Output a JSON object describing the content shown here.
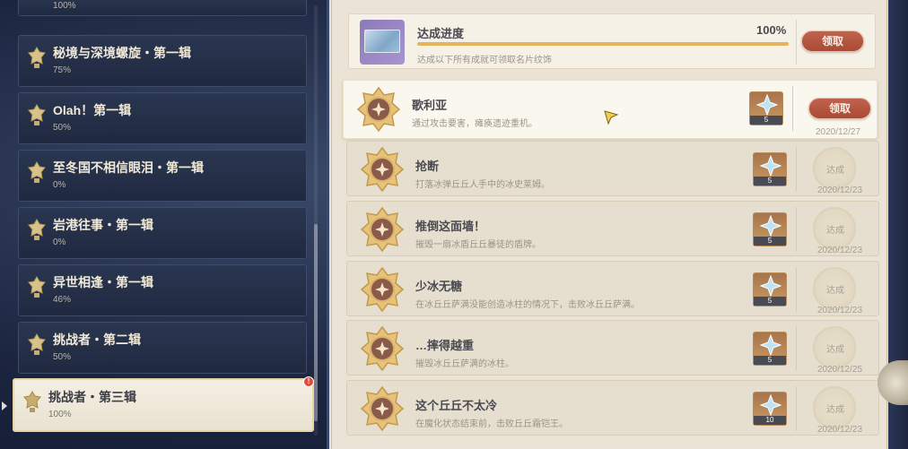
{
  "categories": [
    {
      "title": "",
      "pct": "100%"
    },
    {
      "title": "秘境与深境螺旋・第一辑",
      "pct": "75%"
    },
    {
      "title": "Olah！第一辑",
      "pct": "50%"
    },
    {
      "title": "至冬国不相信眼泪・第一辑",
      "pct": "0%"
    },
    {
      "title": "岩港往事・第一辑",
      "pct": "0%"
    },
    {
      "title": "异世相逢・第一辑",
      "pct": "46%"
    },
    {
      "title": "挑战者・第二辑",
      "pct": "50%"
    },
    {
      "title": "挑战者・第三辑",
      "pct": "100%",
      "badge": "!"
    }
  ],
  "summary": {
    "title": "达成进度",
    "pct": "100%",
    "progress": 1.0,
    "desc": "达成以下所有成就可领取名片纹饰",
    "claim": "领取"
  },
  "achievements": [
    {
      "title": "歌利亚",
      "desc": "通过攻击要害，瘫痪遗迹重机。",
      "reward": "5",
      "status": "claim",
      "action": "领取",
      "date": "2020/12/27"
    },
    {
      "title": "抢断",
      "desc": "打落冰弹丘丘人手中的冰史莱姆。",
      "reward": "5",
      "status": "done",
      "action": "达成",
      "date": "2020/12/23"
    },
    {
      "title": "推倒这面墙！",
      "desc": "摧毁一扇冰盾丘丘暴徒的盾牌。",
      "reward": "5",
      "status": "done",
      "action": "达成",
      "date": "2020/12/23"
    },
    {
      "title": "少冰无糖",
      "desc": "在冰丘丘萨满没能创造冰柱的情况下，击败冰丘丘萨满。",
      "reward": "5",
      "status": "done",
      "action": "达成",
      "date": "2020/12/23"
    },
    {
      "title": "…摔得越重",
      "desc": "摧毁冰丘丘萨满的冰柱。",
      "reward": "5",
      "status": "done",
      "action": "达成",
      "date": "2020/12/25"
    },
    {
      "title": "这个丘丘不太冷",
      "desc": "在魔化状态结束前，击败丘丘霜铠王。",
      "reward": "10",
      "status": "done",
      "action": "达成",
      "date": "2020/12/23"
    }
  ],
  "colors": {
    "accent": "#e5b35c",
    "claim": "#b4523f",
    "panel": "#ebe4d6"
  },
  "icons": {
    "category": "trophy-icon",
    "medal": "achievement-medal-icon",
    "reward": "primogem-icon",
    "cursor": "pointer-cursor-icon"
  }
}
